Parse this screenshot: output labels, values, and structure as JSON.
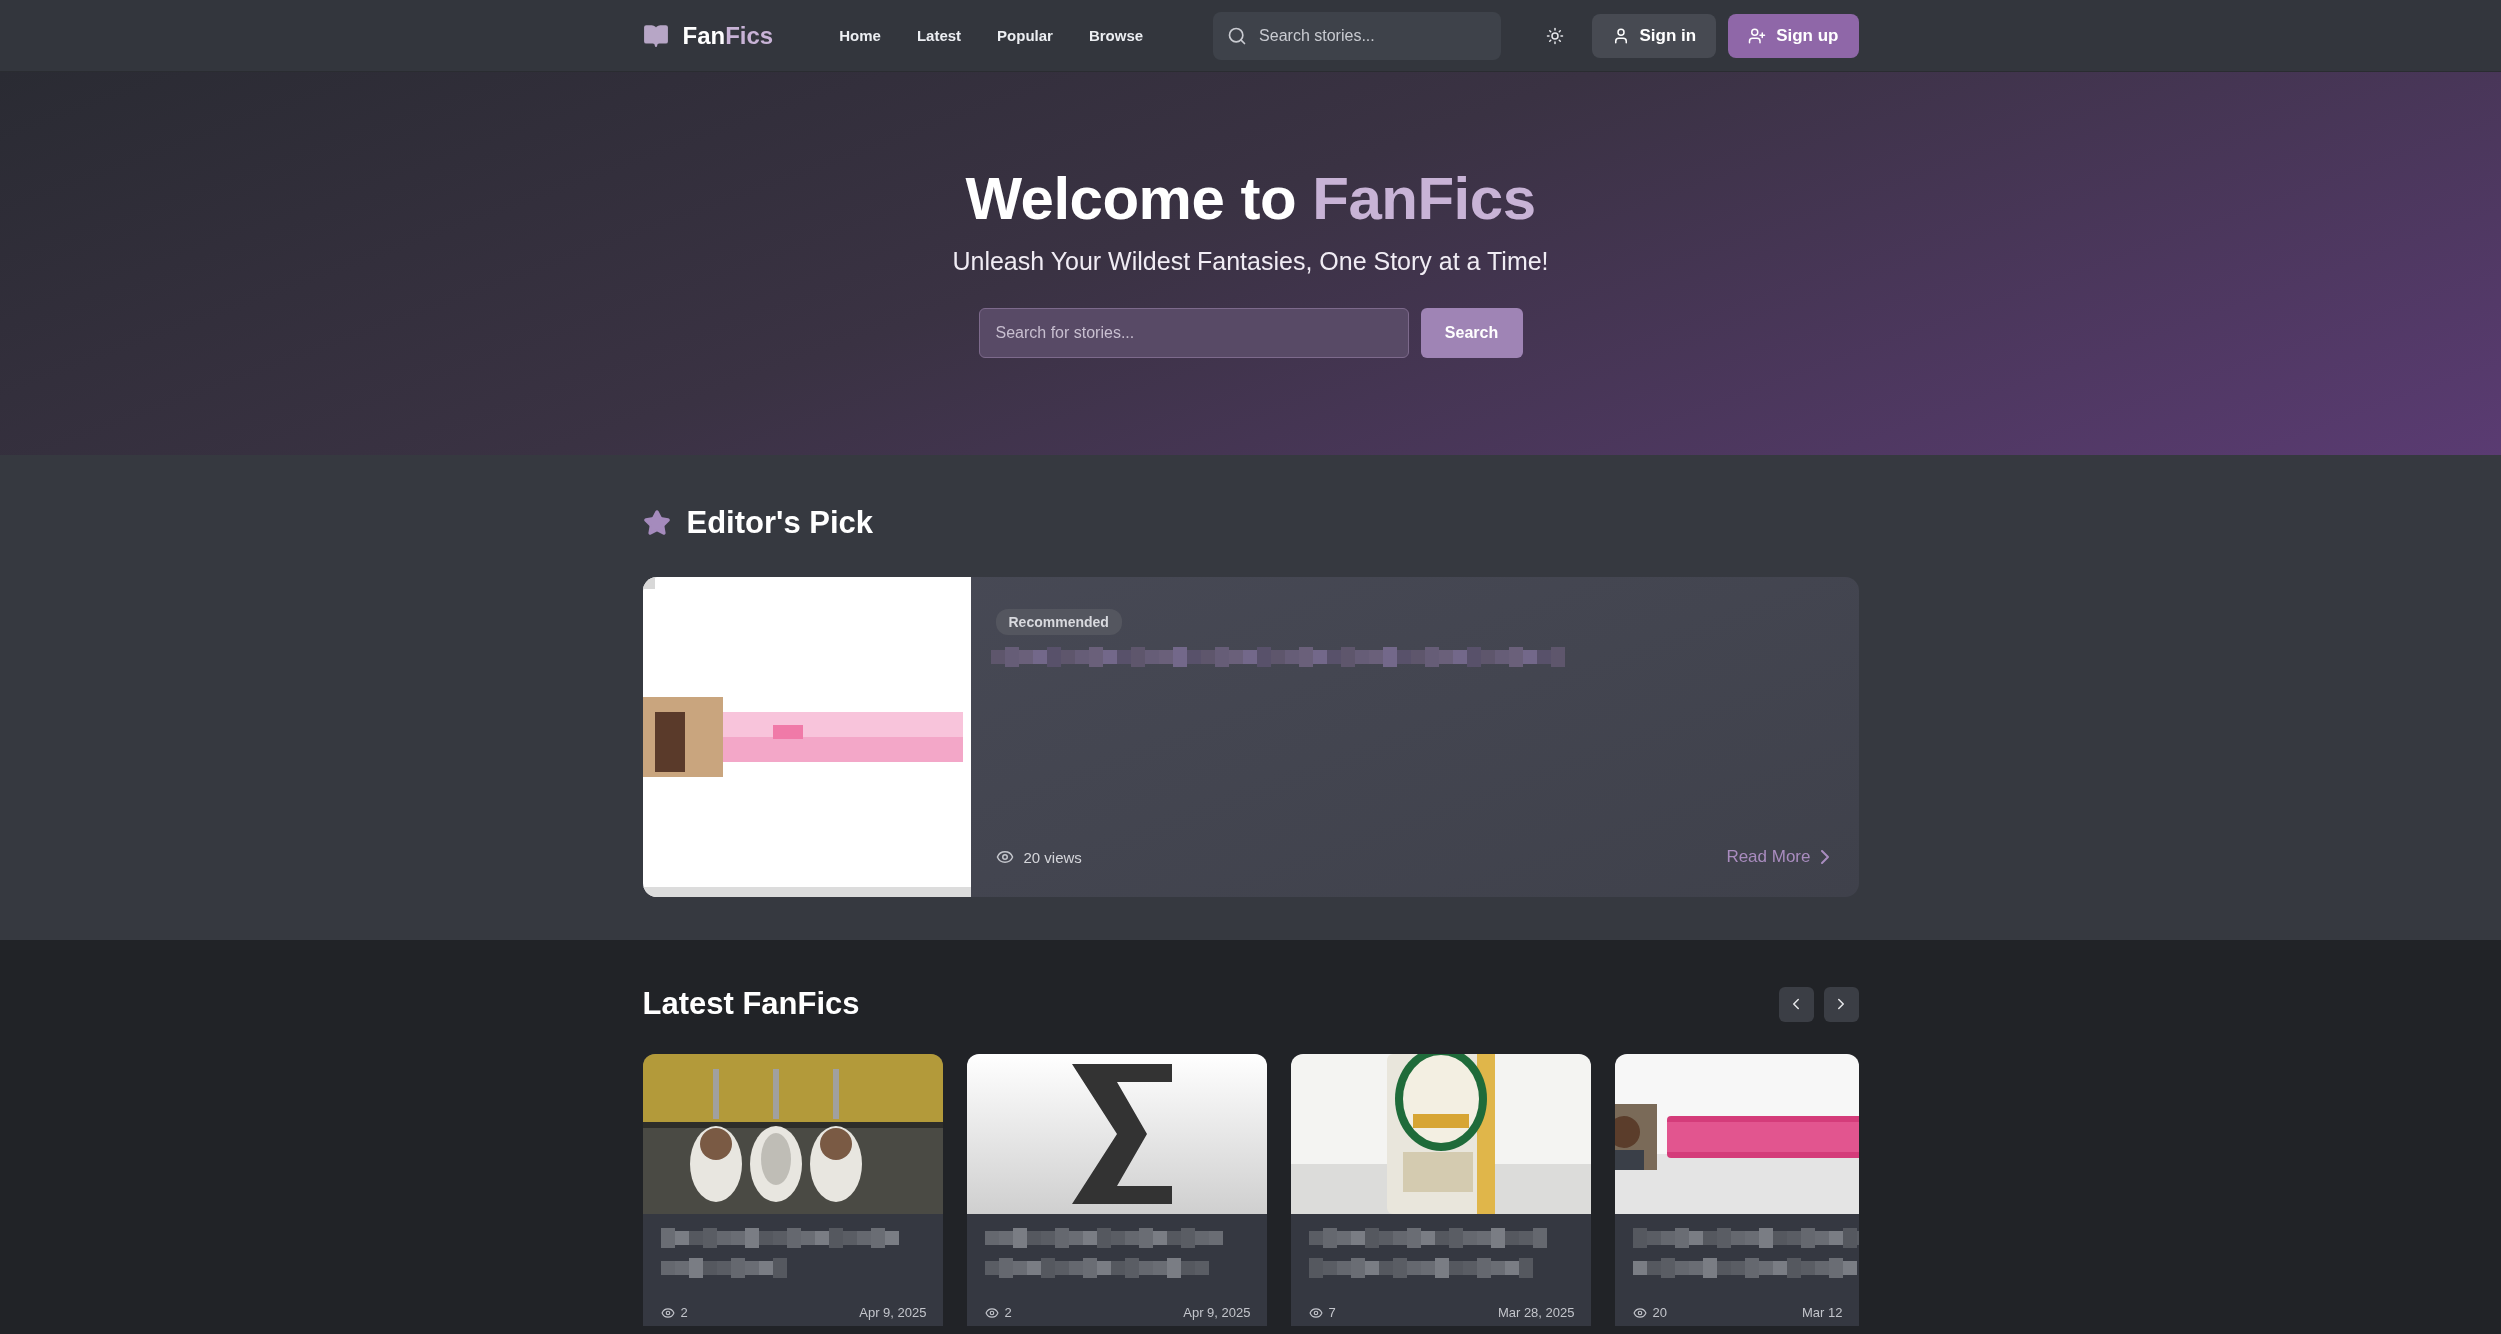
{
  "header": {
    "logo": {
      "first": "Fan",
      "second": "Fics"
    },
    "nav": [
      {
        "label": "Home"
      },
      {
        "label": "Latest"
      },
      {
        "label": "Popular"
      },
      {
        "label": "Browse"
      }
    ],
    "search": {
      "placeholder": "Search stories..."
    },
    "buttons": [
      {
        "label": "Sign in",
        "kind": "secondary"
      },
      {
        "label": "Sign up",
        "kind": "primary"
      }
    ]
  },
  "hero": {
    "title": "Welcome to",
    "title_accent": "FanFics",
    "subtitle": "Unleash Your Wildest Fantasies, One Story at a Time!",
    "search": {
      "placeholder": "Search for stories..."
    },
    "button": "Search"
  },
  "editors_pick": {
    "heading": "Editor's Pick",
    "badge": "Recommended",
    "views": "20 views",
    "link": "Read More"
  },
  "latest": {
    "heading": "Latest FanFics",
    "cards": [
      {
        "views": "2",
        "date": "Apr 9, 2025"
      },
      {
        "views": "2",
        "date": "Apr 9, 2025"
      },
      {
        "views": "7",
        "date": "Mar 28, 2025"
      },
      {
        "views": "20",
        "date": "Mar 12"
      }
    ]
  }
}
